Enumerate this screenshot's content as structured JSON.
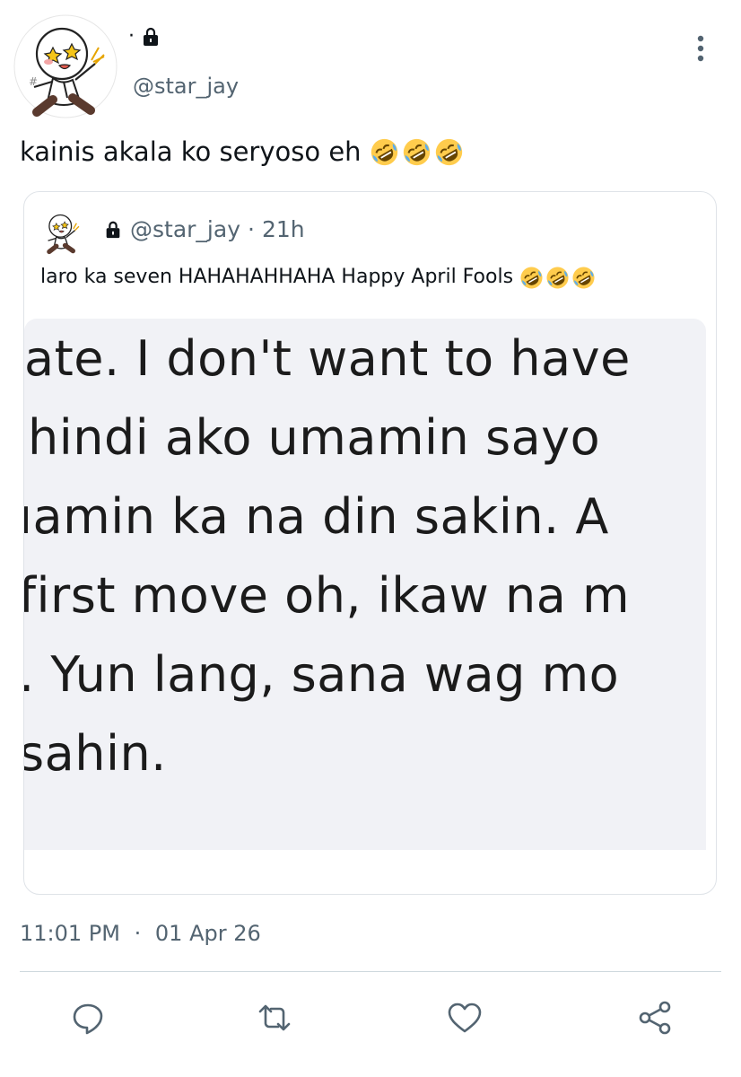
{
  "author": {
    "display_name": "·",
    "handle": "@star_jay",
    "protected_icon": "lock-icon",
    "avatar_icon": "cartoon-avatar"
  },
  "menu": {
    "icon": "more-vertical-icon"
  },
  "tweet": {
    "text": "kainis akala ko seryoso eh ",
    "emojis": [
      "rolling-on-floor-laughing-emoji",
      "rolling-on-floor-laughing-emoji",
      "rolling-on-floor-laughing-emoji"
    ]
  },
  "quote": {
    "handle": "@star_jay",
    "separator": "·",
    "time": "21h",
    "text": "laro ka seven HAHAHAHHAHA Happy April Fools ",
    "emojis": [
      "rolling-on-floor-laughing-emoji",
      "rolling-on-floor-laughing-emoji",
      "rolling-on-floor-laughing-emoji"
    ],
    "image_lines": [
      "ate. I don't want to have",
      " hindi ako umamin sayo",
      "ıamin ka na din sakin. A",
      "first move oh, ikaw na m",
      ". Yun lang, sana wag mo",
      "sahin."
    ]
  },
  "timestamp": {
    "time": "11:01 PM",
    "separator": "·",
    "date": "01 Apr 26"
  },
  "actions": {
    "reply_icon": "reply-icon",
    "retweet_icon": "retweet-icon",
    "like_icon": "heart-icon",
    "share_icon": "share-icon"
  },
  "colors": {
    "text_primary": "#0f1419",
    "text_secondary": "#536471",
    "border": "#dfe3e8",
    "image_bg": "#f1f2f6"
  }
}
